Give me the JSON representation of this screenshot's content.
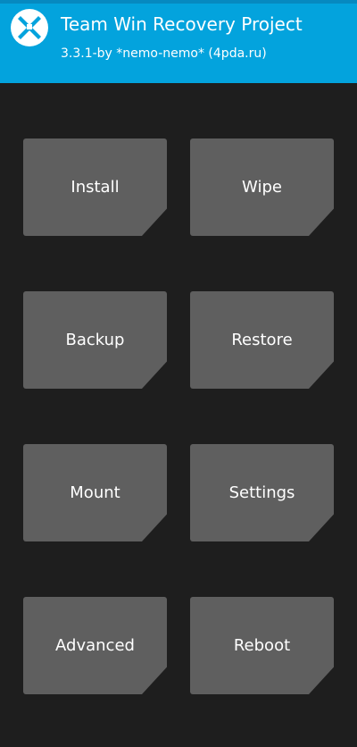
{
  "header": {
    "title": "Team Win Recovery Project",
    "subtitle": "3.3.1-by *nemo-nemo* (4pda.ru)",
    "logo_icon": "twrp-logo-icon",
    "background_color": "#03a3dd"
  },
  "menu": {
    "install_label": "Install",
    "wipe_label": "Wipe",
    "backup_label": "Backup",
    "restore_label": "Restore",
    "mount_label": "Mount",
    "settings_label": "Settings",
    "advanced_label": "Advanced",
    "reboot_label": "Reboot",
    "tile_color": "#5f5f5f"
  },
  "colors": {
    "background": "#1e1e1e",
    "text": "#ffffff"
  }
}
